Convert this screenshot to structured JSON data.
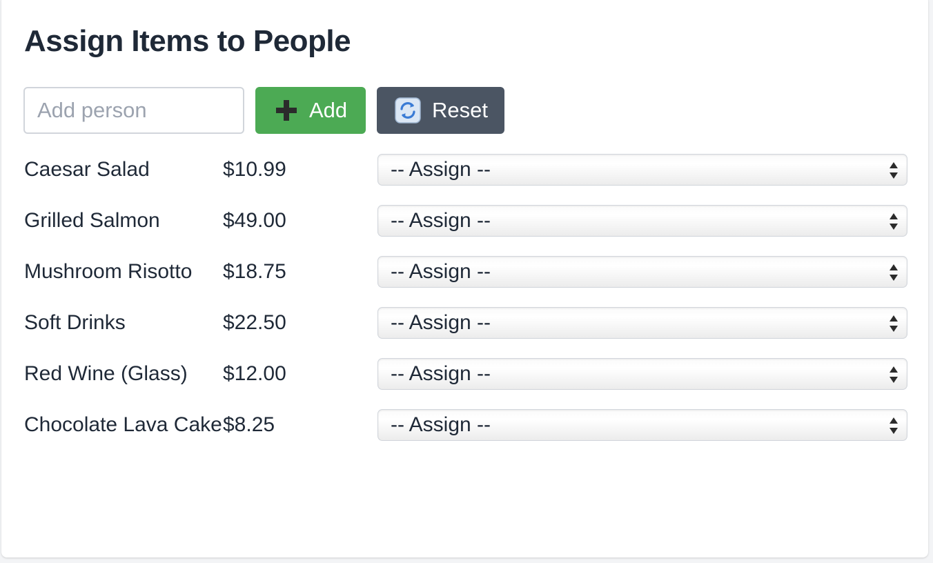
{
  "title": "Assign Items to People",
  "add_person": {
    "placeholder": "Add person",
    "value": ""
  },
  "buttons": {
    "add_label": "Add",
    "reset_label": "Reset"
  },
  "icons": {
    "add": "plus-icon",
    "reset": "refresh-icon"
  },
  "colors": {
    "add_button": "#4caa54",
    "reset_button": "#4b5563",
    "text": "#1f2937",
    "placeholder": "#9ca3af"
  },
  "items": [
    {
      "name": "Caesar Salad",
      "price": "$10.99",
      "assignee": "-- Assign --"
    },
    {
      "name": "Grilled Salmon",
      "price": "$49.00",
      "assignee": "-- Assign --"
    },
    {
      "name": "Mushroom Risotto",
      "price": "$18.75",
      "assignee": "-- Assign --"
    },
    {
      "name": "Soft Drinks",
      "price": "$22.50",
      "assignee": "-- Assign --"
    },
    {
      "name": "Red Wine (Glass)",
      "price": "$12.00",
      "assignee": "-- Assign --"
    },
    {
      "name": "Chocolate Lava Cake",
      "price": "$8.25",
      "assignee": "-- Assign --"
    }
  ]
}
